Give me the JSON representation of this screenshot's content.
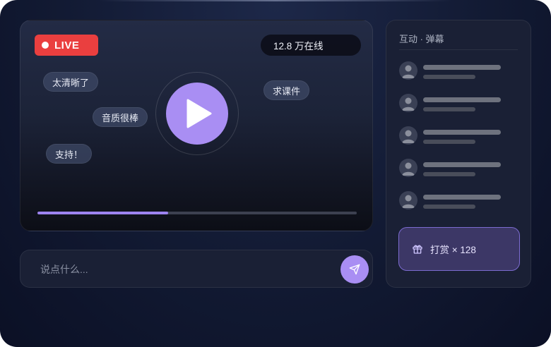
{
  "player": {
    "live_label": "LIVE",
    "viewers": "12.8 万在线",
    "progress": 0.41,
    "danmaku": [
      {
        "text": "太清晰了"
      },
      {
        "text": "音质很棒"
      },
      {
        "text": "支持！"
      },
      {
        "text": "求课件"
      }
    ],
    "icons": {
      "play": "play-icon"
    }
  },
  "chat": {
    "placeholder": "说点什么...",
    "value": "",
    "send_icon": "send-icon"
  },
  "sidebar": {
    "title": "互动 · 弹幕",
    "message_count": 5,
    "gift_label": "打赏 × 128",
    "gift_icon": "gift-icon"
  },
  "colors": {
    "accent": "#a98ef3",
    "live_red": "#ea3f3f",
    "panel_bg": "#1a2035",
    "page_bg": "#121a33"
  }
}
